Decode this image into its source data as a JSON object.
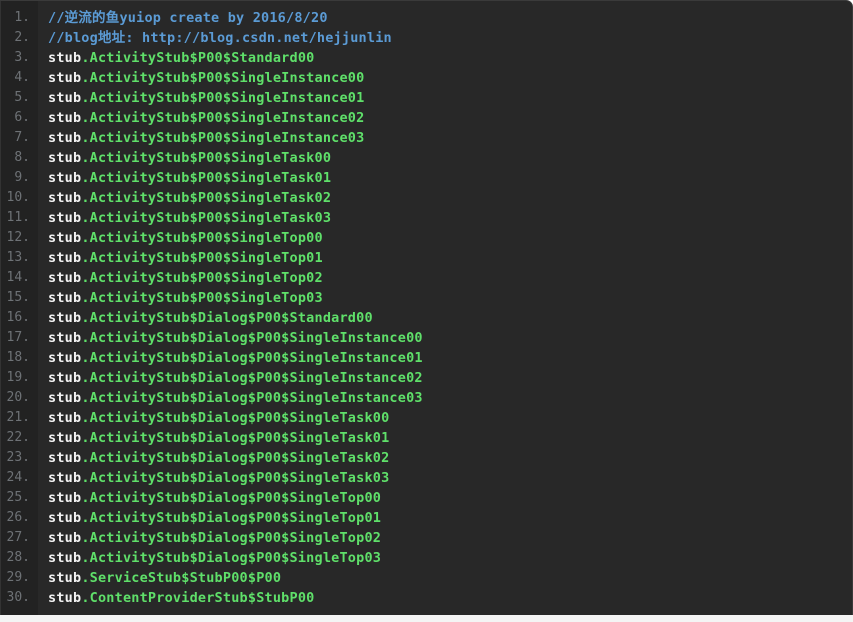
{
  "viewer": {
    "name": "code-block-viewer",
    "language": "text",
    "total_lines": 30,
    "theme": {
      "background": "#282828",
      "gutter_background": "#222222",
      "gutter_number_color": "#6e7276",
      "comment_color": "#5b9bd5",
      "namespace_color": "#f2f2f2",
      "class_color": "#5fe06a",
      "page_background": "#f4f4f4"
    }
  },
  "lines": [
    {
      "number": "1.",
      "type": "comment",
      "comment": "//逆流的鱼yuiop create by 2016/8/20"
    },
    {
      "number": "2.",
      "type": "comment",
      "comment": "//blog地址: http://blog.csdn.net/hejjunlin"
    },
    {
      "number": "3.",
      "type": "code",
      "ns": "stub",
      "cls": ".ActivityStub$P00$Standard00"
    },
    {
      "number": "4.",
      "type": "code",
      "ns": "stub",
      "cls": ".ActivityStub$P00$SingleInstance00"
    },
    {
      "number": "5.",
      "type": "code",
      "ns": "stub",
      "cls": ".ActivityStub$P00$SingleInstance01"
    },
    {
      "number": "6.",
      "type": "code",
      "ns": "stub",
      "cls": ".ActivityStub$P00$SingleInstance02"
    },
    {
      "number": "7.",
      "type": "code",
      "ns": "stub",
      "cls": ".ActivityStub$P00$SingleInstance03"
    },
    {
      "number": "8.",
      "type": "code",
      "ns": "stub",
      "cls": ".ActivityStub$P00$SingleTask00"
    },
    {
      "number": "9.",
      "type": "code",
      "ns": "stub",
      "cls": ".ActivityStub$P00$SingleTask01"
    },
    {
      "number": "10.",
      "type": "code",
      "ns": "stub",
      "cls": ".ActivityStub$P00$SingleTask02"
    },
    {
      "number": "11.",
      "type": "code",
      "ns": "stub",
      "cls": ".ActivityStub$P00$SingleTask03"
    },
    {
      "number": "12.",
      "type": "code",
      "ns": "stub",
      "cls": ".ActivityStub$P00$SingleTop00"
    },
    {
      "number": "13.",
      "type": "code",
      "ns": "stub",
      "cls": ".ActivityStub$P00$SingleTop01"
    },
    {
      "number": "14.",
      "type": "code",
      "ns": "stub",
      "cls": ".ActivityStub$P00$SingleTop02"
    },
    {
      "number": "15.",
      "type": "code",
      "ns": "stub",
      "cls": ".ActivityStub$P00$SingleTop03"
    },
    {
      "number": "16.",
      "type": "code",
      "ns": "stub",
      "cls": ".ActivityStub$Dialog$P00$Standard00"
    },
    {
      "number": "17.",
      "type": "code",
      "ns": "stub",
      "cls": ".ActivityStub$Dialog$P00$SingleInstance00"
    },
    {
      "number": "18.",
      "type": "code",
      "ns": "stub",
      "cls": ".ActivityStub$Dialog$P00$SingleInstance01"
    },
    {
      "number": "19.",
      "type": "code",
      "ns": "stub",
      "cls": ".ActivityStub$Dialog$P00$SingleInstance02"
    },
    {
      "number": "20.",
      "type": "code",
      "ns": "stub",
      "cls": ".ActivityStub$Dialog$P00$SingleInstance03"
    },
    {
      "number": "21.",
      "type": "code",
      "ns": "stub",
      "cls": ".ActivityStub$Dialog$P00$SingleTask00"
    },
    {
      "number": "22.",
      "type": "code",
      "ns": "stub",
      "cls": ".ActivityStub$Dialog$P00$SingleTask01"
    },
    {
      "number": "23.",
      "type": "code",
      "ns": "stub",
      "cls": ".ActivityStub$Dialog$P00$SingleTask02"
    },
    {
      "number": "24.",
      "type": "code",
      "ns": "stub",
      "cls": ".ActivityStub$Dialog$P00$SingleTask03"
    },
    {
      "number": "25.",
      "type": "code",
      "ns": "stub",
      "cls": ".ActivityStub$Dialog$P00$SingleTop00"
    },
    {
      "number": "26.",
      "type": "code",
      "ns": "stub",
      "cls": ".ActivityStub$Dialog$P00$SingleTop01"
    },
    {
      "number": "27.",
      "type": "code",
      "ns": "stub",
      "cls": ".ActivityStub$Dialog$P00$SingleTop02"
    },
    {
      "number": "28.",
      "type": "code",
      "ns": "stub",
      "cls": ".ActivityStub$Dialog$P00$SingleTop03"
    },
    {
      "number": "29.",
      "type": "code",
      "ns": "stub",
      "cls": ".ServiceStub$StubP00$P00"
    },
    {
      "number": "30.",
      "type": "code",
      "ns": "stub",
      "cls": ".ContentProviderStub$StubP00"
    }
  ]
}
